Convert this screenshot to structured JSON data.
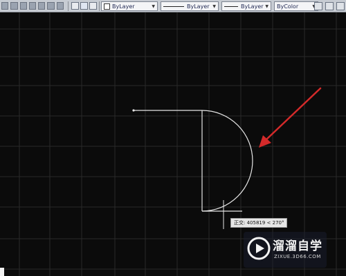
{
  "toolbar": {
    "color_combo": {
      "value": "ByLayer",
      "swatch_color": "#ffffff"
    },
    "linetype_combo": {
      "value": "ByLayer"
    },
    "lineweight_combo": {
      "value": "ByLayer"
    },
    "plotstyle_combo": {
      "value": "ByColor"
    }
  },
  "canvas": {
    "background": "#0b0b0b",
    "grid_color": "#2a2a2a",
    "geometry_color": "#e6e6e6",
    "arrow_color": "#d42a2a"
  },
  "tooltip": {
    "text": "正交: 405819 < 270°"
  },
  "watermark": {
    "title": "溜溜自学",
    "url": "ZIXUE.3D66.COM"
  },
  "icons": [
    "layer-icon",
    "match-properties-icon",
    "layer-previous-icon",
    "dropdown-arrow-icon",
    "play-logo-icon",
    "ucs-icon"
  ]
}
